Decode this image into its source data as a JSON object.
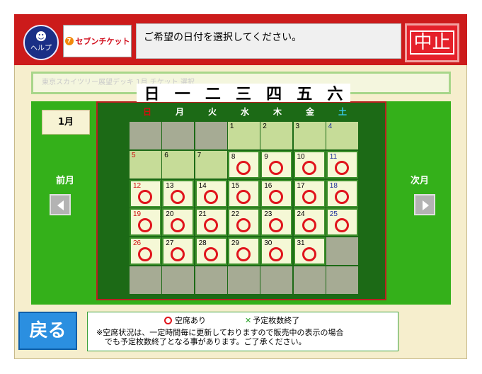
{
  "header": {
    "help_label": "ヘルプ",
    "logo_text": "セブンチケット",
    "message": "ご希望の日付を選択してください。",
    "stop_label": "中止"
  },
  "venue_text": "東京スカイツリー展望デッキ 1月 チケット 選択",
  "calendar": {
    "month_label": "1月",
    "prev_label": "前月",
    "next_label": "次月",
    "weekday_heading": [
      "日",
      "一",
      "二",
      "三",
      "四",
      "五",
      "六"
    ],
    "weekday_small": [
      "日",
      "月",
      "火",
      "水",
      "木",
      "金",
      "土"
    ],
    "weekday_colors": [
      "#d01010",
      "#ffffff",
      "#ffffff",
      "#ffffff",
      "#ffffff",
      "#ffffff",
      "#38c8e8"
    ],
    "rows": [
      [
        {
          "d": "",
          "s": "empty"
        },
        {
          "d": "",
          "s": "empty"
        },
        {
          "d": "",
          "s": "empty"
        },
        {
          "d": "1",
          "s": "plain"
        },
        {
          "d": "2",
          "s": "plain"
        },
        {
          "d": "3",
          "s": "plain"
        },
        {
          "d": "4",
          "s": "plain"
        }
      ],
      [
        {
          "d": "5",
          "s": "plain"
        },
        {
          "d": "6",
          "s": "plain"
        },
        {
          "d": "7",
          "s": "plain"
        },
        {
          "d": "8",
          "s": "avail"
        },
        {
          "d": "9",
          "s": "avail"
        },
        {
          "d": "10",
          "s": "avail"
        },
        {
          "d": "11",
          "s": "avail"
        }
      ],
      [
        {
          "d": "12",
          "s": "avail"
        },
        {
          "d": "13",
          "s": "avail"
        },
        {
          "d": "14",
          "s": "avail"
        },
        {
          "d": "15",
          "s": "avail"
        },
        {
          "d": "16",
          "s": "avail"
        },
        {
          "d": "17",
          "s": "avail"
        },
        {
          "d": "18",
          "s": "avail"
        }
      ],
      [
        {
          "d": "19",
          "s": "avail"
        },
        {
          "d": "20",
          "s": "avail"
        },
        {
          "d": "21",
          "s": "avail"
        },
        {
          "d": "22",
          "s": "avail"
        },
        {
          "d": "23",
          "s": "avail"
        },
        {
          "d": "24",
          "s": "avail"
        },
        {
          "d": "25",
          "s": "avail"
        }
      ],
      [
        {
          "d": "26",
          "s": "avail"
        },
        {
          "d": "27",
          "s": "avail"
        },
        {
          "d": "28",
          "s": "avail"
        },
        {
          "d": "29",
          "s": "avail"
        },
        {
          "d": "30",
          "s": "avail"
        },
        {
          "d": "31",
          "s": "avail"
        },
        {
          "d": "",
          "s": "empty"
        }
      ],
      [
        {
          "d": "",
          "s": "empty"
        },
        {
          "d": "",
          "s": "empty"
        },
        {
          "d": "",
          "s": "empty"
        },
        {
          "d": "",
          "s": "empty"
        },
        {
          "d": "",
          "s": "empty"
        },
        {
          "d": "",
          "s": "empty"
        },
        {
          "d": "",
          "s": "empty"
        }
      ]
    ]
  },
  "legend": {
    "available": "空席あり",
    "soldout": "予定枚数終了",
    "note_line1": "※空席状況は、一定時間毎に更新しておりますので販売中の表示の場合",
    "note_line2": "でも予定枚数終了となる事があります。ご了承ください。"
  },
  "back_label": "戻る",
  "icons": {
    "help": "help-face-icon",
    "prev": "left-arrow-icon",
    "next": "right-arrow-icon",
    "available": "circle-icon",
    "soldout": "x-mark-icon"
  }
}
